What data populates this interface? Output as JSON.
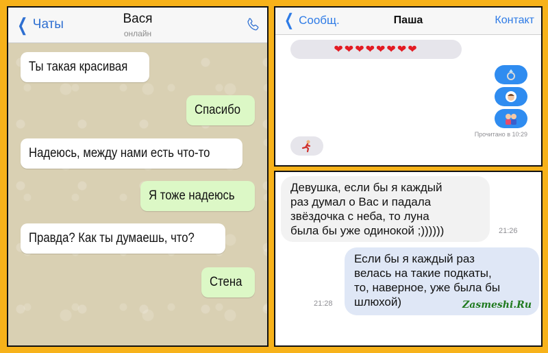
{
  "left_chat": {
    "back_label": "Чаты",
    "contact_name": "Вася",
    "contact_status": "онлайн",
    "messages": [
      {
        "dir": "in",
        "text": "Ты такая красивая"
      },
      {
        "dir": "out",
        "text": "Спасибо"
      },
      {
        "dir": "in",
        "text": "Надеюсь, между нами есть что-то"
      },
      {
        "dir": "out",
        "text": "Я тоже надеюсь"
      },
      {
        "dir": "in",
        "text": "Правда? Как ты думаешь, что?"
      },
      {
        "dir": "out",
        "text": "Стена"
      }
    ],
    "colors": {
      "incoming": "#ffffff",
      "outgoing": "#dcf8c6",
      "accent": "#2e6fd1"
    }
  },
  "imessage": {
    "back_label": "Сообщ.",
    "title": "Паша",
    "contact_label": "Контакт",
    "hearts": "❤❤❤❤❤❤❤❤",
    "read_receipt": "Прочитано в 10:29",
    "emoji_icons": [
      "ring-icon",
      "bride-icon",
      "couple-icon",
      "runner-icon"
    ],
    "colors": {
      "outgoing": "#2f8cf0",
      "incoming": "#e6e5eb",
      "accent": "#2e7be6"
    }
  },
  "sms": {
    "incoming_lines": [
      "Девушка, если бы я каждый",
      "раз думал о Вас и падала",
      "звёздочка с неба, то луна",
      "была бы уже одинокой ;))))))"
    ],
    "incoming_time": "21:26",
    "outgoing_lines": [
      "Если бы я каждый раз",
      "велась на такие подкаты,",
      "то, наверное, уже была бы",
      "шлюхой)"
    ],
    "outgoing_time": "21:28",
    "watermark": "Zasmeshi.Ru"
  }
}
